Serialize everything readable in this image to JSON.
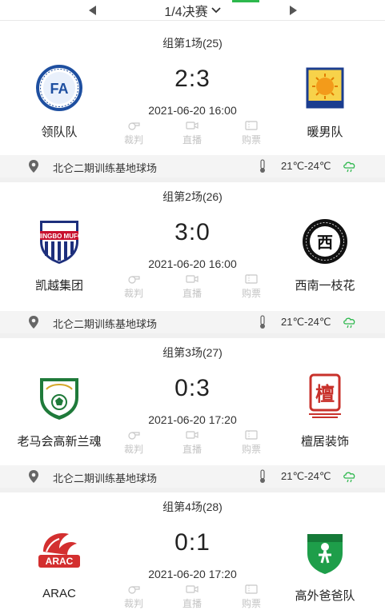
{
  "nav": {
    "round_label": "1/4决赛",
    "prev_icon": "triangle-left-icon",
    "next_icon": "triangle-right-icon",
    "dropdown_icon": "chevron-down-icon",
    "accent_color": "#2db84d"
  },
  "action_labels": {
    "referee": "裁判",
    "live": "直播",
    "ticket": "购票"
  },
  "matches": [
    {
      "group": "组第1场(25)",
      "home": {
        "name": "领队队"
      },
      "away": {
        "name": "暖男队"
      },
      "score": "2:3",
      "datetime": "2021-06-20 16:00",
      "venue": "北仑二期训练基地球场",
      "temperature": "21℃-24℃"
    },
    {
      "group": "组第2场(26)",
      "home": {
        "name": "凯越集团",
        "logo_text": "NINGBO MUFC"
      },
      "away": {
        "name": "西南一枝花",
        "logo_text": "西"
      },
      "score": "3:0",
      "datetime": "2021-06-20 16:00",
      "venue": "北仑二期训练基地球场",
      "temperature": "21℃-24℃"
    },
    {
      "group": "组第3场(27)",
      "home": {
        "name": "老马会高新兰魂"
      },
      "away": {
        "name": "檀居装饰",
        "logo_text": "檀"
      },
      "score": "0:3",
      "datetime": "2021-06-20 17:20",
      "venue": "北仑二期训练基地球场",
      "temperature": "21℃-24℃"
    },
    {
      "group": "组第4场(28)",
      "home": {
        "name": "ARAC",
        "logo_text": "ARAC"
      },
      "away": {
        "name": "高外爸爸队"
      },
      "score": "0:1",
      "datetime": "2021-06-20 17:20"
    }
  ]
}
